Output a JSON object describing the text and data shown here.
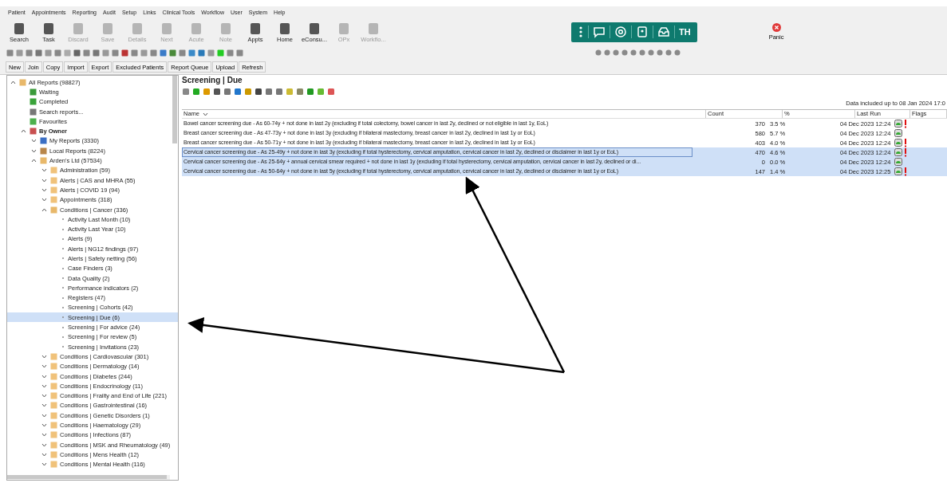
{
  "menu": [
    "Patient",
    "Appointments",
    "Reporting",
    "Audit",
    "Setup",
    "Links",
    "Clinical Tools",
    "Workflow",
    "User",
    "System",
    "Help"
  ],
  "toolbar": [
    {
      "label": "Search",
      "disabled": false
    },
    {
      "label": "Task",
      "disabled": false
    },
    {
      "label": "Discard",
      "disabled": true
    },
    {
      "label": "Save",
      "disabled": true
    },
    {
      "label": "Details",
      "disabled": true
    },
    {
      "label": "Next",
      "disabled": true
    },
    {
      "label": "Acute",
      "disabled": true
    },
    {
      "label": "Note",
      "disabled": true
    },
    {
      "label": "Appts",
      "disabled": false
    },
    {
      "label": "Home",
      "disabled": false
    },
    {
      "label": "eConsu...",
      "disabled": false
    },
    {
      "label": "OPx",
      "disabled": true
    },
    {
      "label": "Workflo...",
      "disabled": true
    }
  ],
  "teal_bar": {
    "initials": "TH"
  },
  "panic": {
    "label": "Panic"
  },
  "report_buttons": [
    "New",
    "Join",
    "Copy",
    "Import",
    "Export",
    "Excluded Patients",
    "Report Queue",
    "Upload",
    "Refresh"
  ],
  "tree": [
    {
      "label": "All Reports (98827)",
      "kind": "report",
      "expanded": true,
      "selected": false,
      "children": [
        {
          "label": "Waiting",
          "kind": "waiting",
          "selected": false
        },
        {
          "label": "Completed",
          "kind": "tick",
          "selected": false
        },
        {
          "label": "Search reports...",
          "kind": "search",
          "selected": false
        },
        {
          "label": "Favourites",
          "kind": "refresh",
          "selected": false
        },
        {
          "label": "By Owner",
          "kind": "owner",
          "expanded": true,
          "selected": false,
          "children": [
            {
              "label": "My Reports (3330)",
              "kind": "person",
              "expanded": false,
              "selected": false
            },
            {
              "label": "Local Reports (8224)",
              "kind": "building",
              "expanded": false,
              "selected": false
            },
            {
              "label": "Arden's Ltd (57534)",
              "kind": "report",
              "expanded": true,
              "selected": false,
              "children": [
                {
                  "label": "Administration (59)",
                  "kind": "folder",
                  "expanded": false,
                  "selected": false
                },
                {
                  "label": "Alerts | CAS and MHRA (55)",
                  "kind": "folder",
                  "expanded": false,
                  "selected": false
                },
                {
                  "label": "Alerts | COVID 19 (94)",
                  "kind": "folder",
                  "expanded": false,
                  "selected": false
                },
                {
                  "label": "Appointments (318)",
                  "kind": "folder",
                  "expanded": false,
                  "selected": false
                },
                {
                  "label": "Conditions | Cancer (336)",
                  "kind": "report",
                  "expanded": true,
                  "selected": false,
                  "children": [
                    {
                      "label": "Activity Last Month (10)",
                      "kind": "leaf",
                      "selected": false
                    },
                    {
                      "label": "Activity Last Year (10)",
                      "kind": "leaf",
                      "selected": false
                    },
                    {
                      "label": "Alerts (9)",
                      "kind": "leaf",
                      "selected": false
                    },
                    {
                      "label": "Alerts | NG12 findings (97)",
                      "kind": "leaf",
                      "selected": false
                    },
                    {
                      "label": "Alerts | Safety netting (56)",
                      "kind": "leaf",
                      "selected": false
                    },
                    {
                      "label": "Case Finders (3)",
                      "kind": "leaf",
                      "selected": false
                    },
                    {
                      "label": "Data Quality (2)",
                      "kind": "leaf",
                      "selected": false
                    },
                    {
                      "label": "Performance indicators (2)",
                      "kind": "leaf",
                      "selected": false
                    },
                    {
                      "label": "Registers (47)",
                      "kind": "leaf",
                      "selected": false
                    },
                    {
                      "label": "Screening | Cohorts (42)",
                      "kind": "leaf",
                      "selected": false
                    },
                    {
                      "label": "Screening | Due (6)",
                      "kind": "leaf",
                      "selected": true
                    },
                    {
                      "label": "Screening | For advice (24)",
                      "kind": "leaf",
                      "selected": false
                    },
                    {
                      "label": "Screening | For review (5)",
                      "kind": "leaf",
                      "selected": false
                    },
                    {
                      "label": "Screening | Invitations (23)",
                      "kind": "leaf",
                      "selected": false
                    }
                  ]
                },
                {
                  "label": "Conditions | Cardiovascular (301)",
                  "kind": "folder",
                  "expanded": false,
                  "selected": false
                },
                {
                  "label": "Conditions | Dermatology (14)",
                  "kind": "folder",
                  "expanded": false,
                  "selected": false
                },
                {
                  "label": "Conditions | Diabetes (244)",
                  "kind": "folder",
                  "expanded": false,
                  "selected": false
                },
                {
                  "label": "Conditions | Endocrinology (11)",
                  "kind": "folder",
                  "expanded": false,
                  "selected": false
                },
                {
                  "label": "Conditions | Frailty and End of Life (221)",
                  "kind": "folder",
                  "expanded": false,
                  "selected": false
                },
                {
                  "label": "Conditions | Gastrointestinal (16)",
                  "kind": "folder",
                  "expanded": false,
                  "selected": false
                },
                {
                  "label": "Conditions | Genetic Disorders (1)",
                  "kind": "folder",
                  "expanded": false,
                  "selected": false
                },
                {
                  "label": "Conditions | Haematology (29)",
                  "kind": "folder",
                  "expanded": false,
                  "selected": false
                },
                {
                  "label": "Conditions | Infections (87)",
                  "kind": "folder",
                  "expanded": false,
                  "selected": false
                },
                {
                  "label": "Conditions | MSK and Rheumatology (49)",
                  "kind": "folder",
                  "expanded": false,
                  "selected": false
                },
                {
                  "label": "Conditions | Mens Health (12)",
                  "kind": "folder",
                  "expanded": false,
                  "selected": false
                },
                {
                  "label": "Conditions | Mental Health (116)",
                  "kind": "folder",
                  "expanded": false,
                  "selected": false
                }
              ]
            }
          ]
        }
      ]
    }
  ],
  "report": {
    "title": "Screening | Due",
    "data_note": "Data included up to 08 Jan 2024 17:0",
    "columns": [
      "Name",
      "Count",
      "%",
      "Last Run",
      "Flags"
    ],
    "rows": [
      {
        "name": "Bowel cancer screening due - As 60-74y + not done in last 2y (excluding if total colectomy, bowel cancer in last 2y, declined or not eligible in last 1y, EoL)",
        "count": "370",
        "pct": "3.5 %",
        "last_run": "04 Dec 2023 12:24",
        "alert": true,
        "selected": false
      },
      {
        "name": "Breast cancer screening due - As 47-73y + not done in last 3y (excluding if bilateral mastectomy, breast cancer in last 2y, declined in last 1y or EoL)",
        "count": "580",
        "pct": "5.7 %",
        "last_run": "04 Dec 2023 12:24",
        "alert": false,
        "selected": false
      },
      {
        "name": "Breast cancer screening due - As 50-71y + not done in last 3y (excluding if bilateral mastectomy, breast cancer in last 2y, declined in last 1y or EoL)",
        "count": "403",
        "pct": "4.0 %",
        "last_run": "04 Dec 2023 12:24",
        "alert": true,
        "selected": false
      },
      {
        "name": "Cervical cancer screening due - As 25-49y + not done in last 3y (excluding if total hysterectomy, cervical amputation, cervical cancer in last 2y, declined or disclaimer in last 1y or EoL)",
        "count": "470",
        "pct": "4.6 %",
        "last_run": "04 Dec 2023 12:24",
        "alert": true,
        "selected": true
      },
      {
        "name": "Cervical cancer screening due - As 25-64y + annual cervical smear required + not done in last 1y (excluding if total hysterectomy, cervical amputation, cervical cancer in last 2y, declined or di...",
        "count": "0",
        "pct": "0.0 %",
        "last_run": "04 Dec 2023 12:24",
        "alert": false,
        "selected": true
      },
      {
        "name": "Cervical cancer screening due - As 50-64y + not done in last 5y (excluding if total hysterectomy, cervical amputation, cervical cancer in last 2y, declined or disclaimer in last 1y or EoL)",
        "count": "147",
        "pct": "1.4 %",
        "last_run": "04 Dec 2023 12:25",
        "alert": true,
        "selected": true
      }
    ]
  }
}
